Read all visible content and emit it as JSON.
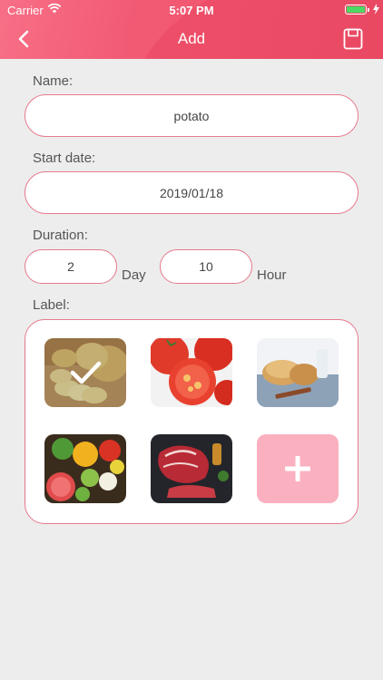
{
  "status_bar": {
    "carrier": "Carrier",
    "time": "5:07 PM"
  },
  "nav": {
    "title": "Add"
  },
  "form": {
    "name_label": "Name:",
    "name_value": "potato",
    "start_label": "Start date:",
    "start_value": "2019/01/18",
    "duration_label": "Duration:",
    "days_value": "2",
    "days_unit": "Day",
    "hours_value": "10",
    "hours_unit": "Hour",
    "label_label": "Label:"
  },
  "labels": [
    {
      "name": "potato",
      "selected": true
    },
    {
      "name": "tomato",
      "selected": false
    },
    {
      "name": "bread",
      "selected": false
    },
    {
      "name": "vegetables",
      "selected": false
    },
    {
      "name": "meat",
      "selected": false
    }
  ],
  "colors": {
    "accent": "#f25a74",
    "border": "#e77a8e",
    "add_tile": "#fbb0bf"
  }
}
